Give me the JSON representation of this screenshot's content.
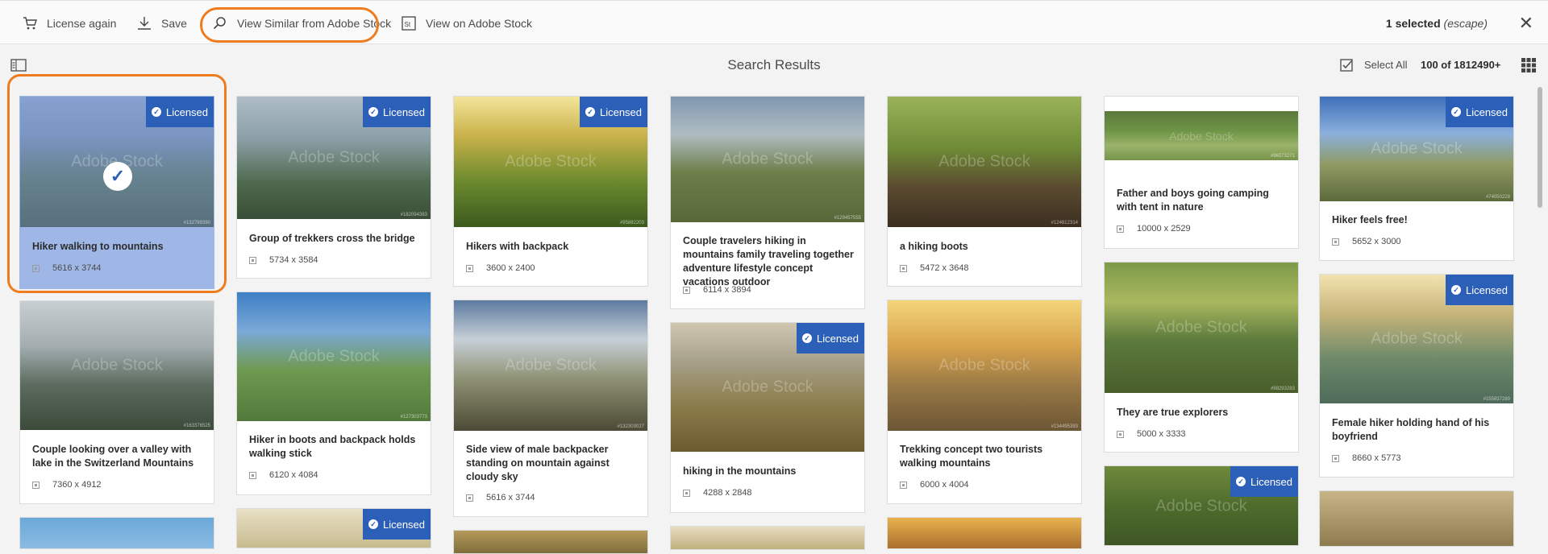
{
  "toolbar": {
    "license_again": "License again",
    "save": "Save",
    "view_similar": "View Similar from Adobe Stock",
    "view_on_stock": "View on Adobe Stock",
    "selected_count": "1 selected",
    "escape_hint": "(escape)"
  },
  "header": {
    "title": "Search Results",
    "select_all": "Select All",
    "count": "100 of 1812490+"
  },
  "badge_label": "Licensed",
  "watermark": "Adobe Stock",
  "cards": [
    {
      "title": "Hiker walking to mountains",
      "dims": "5616 x 3744",
      "sid": "#132789390"
    },
    {
      "title": "Group of trekkers cross the bridge",
      "dims": "5734 x 3584",
      "sid": "#182094383"
    },
    {
      "title": "Hikers with backpack",
      "dims": "3600 x 2400",
      "sid": "#95882203"
    },
    {
      "title": "Couple travelers hiking in mountains family traveling together adventure lifestyle concept vacations outdoor",
      "dims": "6114 x 3894",
      "sid": "#129457555"
    },
    {
      "title": "a hiking boots",
      "dims": "5472 x 3648",
      "sid": "#124812314"
    },
    {
      "title": "Father and boys going camping with tent in nature",
      "dims": "10000 x 2529",
      "sid": "#96073271"
    },
    {
      "title": "Hiker feels free!",
      "dims": "5652 x 3000",
      "sid": "#74050228"
    },
    {
      "title": "Couple looking over a valley with lake in the Switzerland Mountains",
      "dims": "7360 x 4912",
      "sid": "#163376525"
    },
    {
      "title": "Hiker in boots and backpack holds walking stick",
      "dims": "6120 x 4084",
      "sid": "#127303773"
    },
    {
      "title": "Side view of male backpacker standing on mountain against cloudy sky",
      "dims": "5616 x 3744",
      "sid": "#132303027"
    },
    {
      "title": "hiking in the mountains",
      "dims": "4288 x 2848",
      "sid": ""
    },
    {
      "title": "Trekking concept two tourists walking mountains",
      "dims": "6000 x 4004",
      "sid": "#134495393"
    },
    {
      "title": "They are true explorers",
      "dims": "5000 x 3333",
      "sid": "#98293283"
    },
    {
      "title": "Female hiker holding hand of his boyfriend",
      "dims": "8660 x 5773",
      "sid": "#155837289"
    }
  ],
  "colors": {
    "accent": "#2c5fb8",
    "highlight": "#ee7b1d",
    "selected_bg": "#9fb7e6"
  }
}
